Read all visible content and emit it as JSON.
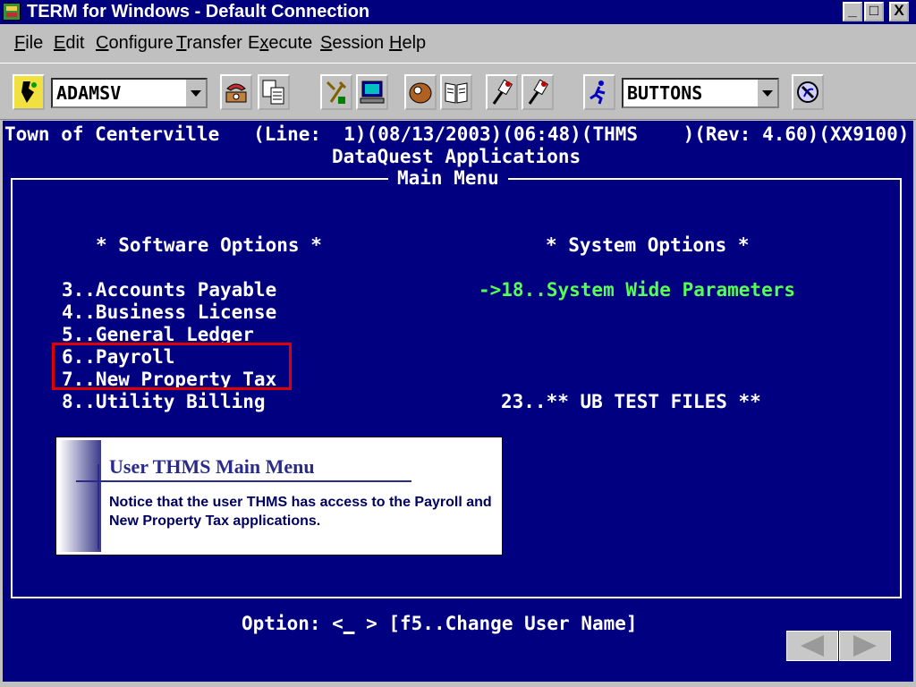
{
  "window": {
    "title": "TERM for Windows - Default Connection",
    "minimize": "_",
    "maximize": "□",
    "close": "X"
  },
  "menubar": {
    "items": [
      {
        "key": "F",
        "rest": "ile"
      },
      {
        "key": "E",
        "rest": "dit"
      },
      {
        "key": "C",
        "rest": "onfigure"
      },
      {
        "key": "T",
        "rest": "ransfer"
      },
      {
        "key": "E",
        "pre": "",
        "rest": "xecute",
        "label": "Execute"
      },
      {
        "key": "S",
        "rest": "ession"
      },
      {
        "key": "H",
        "rest": "elp"
      }
    ]
  },
  "toolbar": {
    "connection_combo": "ADAMSV",
    "buttons_combo": "BUTTONS",
    "icons": [
      "connect-icon",
      "phone-icon",
      "copy-icon",
      "tools-icon",
      "computer-icon",
      "baseball-glove-icon",
      "book-icon",
      "send-file-icon",
      "receive-file-icon",
      "run-icon",
      "phone-off-icon"
    ]
  },
  "terminal": {
    "header_line": "Town of Centerville   (Line:  1)(08/13/2003)(06:48)(THMS    )(Rev: 4.60)(XX9100)",
    "app_title": "DataQuest Applications",
    "box_title": "Main Menu",
    "software_heading": "* Software Options *",
    "system_heading": "* System Options *",
    "software_options": [
      "3..Accounts Payable",
      "4..Business License",
      "5..General Ledger",
      "6..Payroll",
      "7..New Property Tax",
      "8..Utility Billing"
    ],
    "system_options": [
      "->18..System Wide Parameters",
      "23..** UB TEST FILES **"
    ],
    "prompt_prefix": "Option: <",
    "prompt_cursor": "_",
    "prompt_suffix": " > [f5..Change User Name]"
  },
  "callout": {
    "title": "User THMS Main Menu",
    "body": "Notice that the user THMS has access to the Payroll and New Property Tax applications."
  },
  "colors": {
    "terminal_bg": "#000080",
    "selected_option": "#55ff55",
    "highlight_border": "#e00000"
  }
}
